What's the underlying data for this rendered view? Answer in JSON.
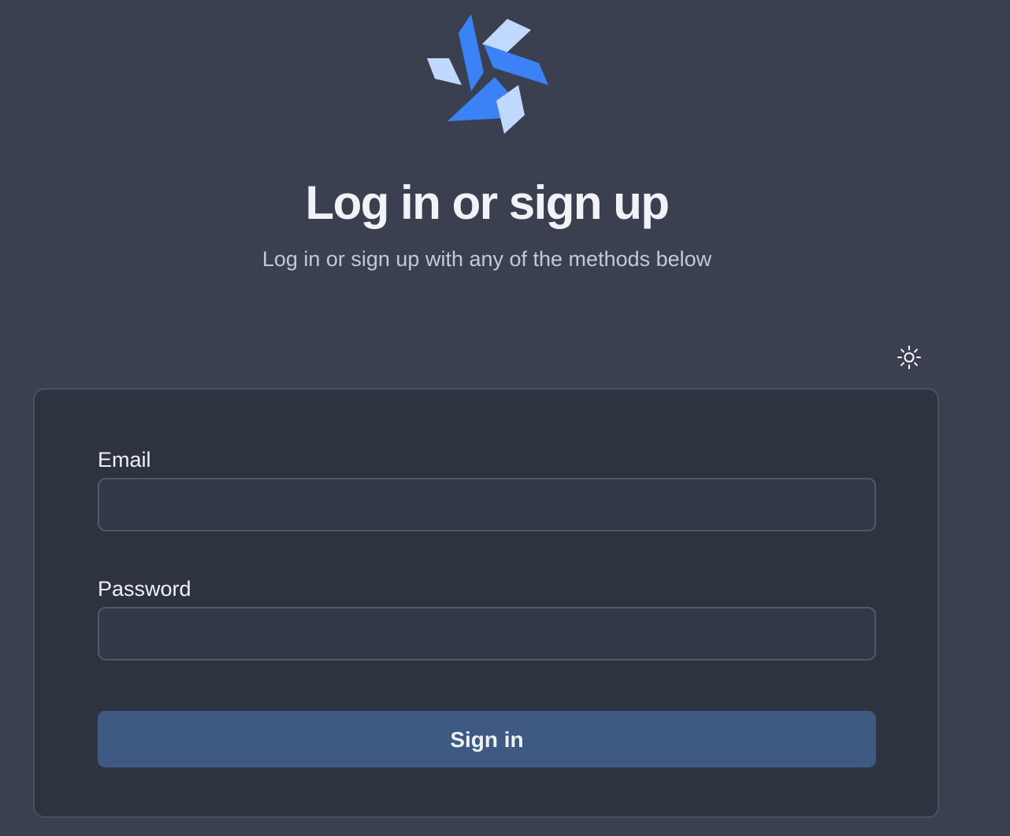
{
  "header": {
    "logo_icon": "pinwheel-logo",
    "title": "Log in or sign up",
    "subtitle": "Log in or sign up with any of the methods below"
  },
  "theme_toggle": {
    "icon": "sun-icon"
  },
  "form": {
    "email_label": "Email",
    "email_value": "",
    "password_label": "Password",
    "password_value": "",
    "submit_label": "Sign in"
  },
  "colors": {
    "background": "#3a4050",
    "card": "#2e3340",
    "accent_blue": "#3b82f6",
    "accent_light": "#c2d9ff",
    "button": "#3e5a82"
  }
}
